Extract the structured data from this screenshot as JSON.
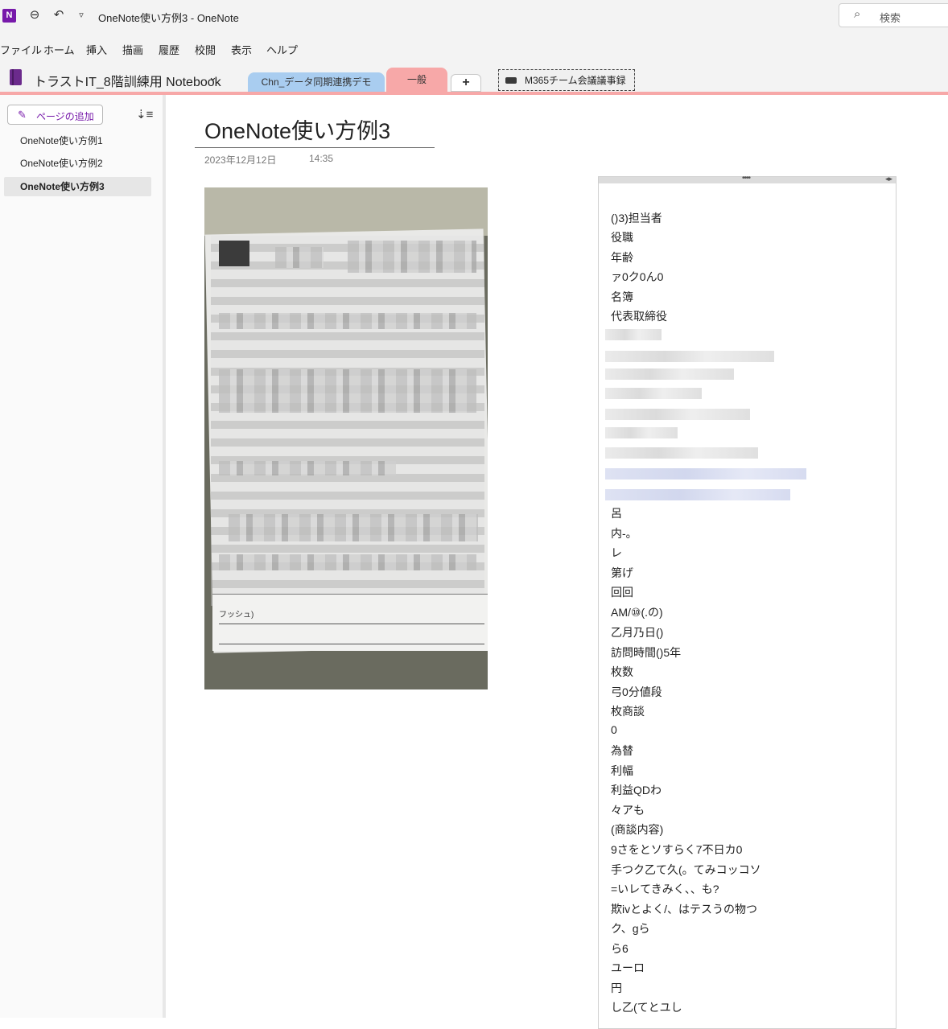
{
  "titlebar": {
    "app_icon": "N",
    "window_title": "OneNote使い方例3  -  OneNote",
    "back_icon": "arrow-left-circle",
    "undo_icon": "undo",
    "customize_icon": "caret-down",
    "search_placeholder": "検索",
    "search_icon": "magnifier"
  },
  "menu": {
    "items": [
      "ファイル",
      "ホーム",
      "挿入",
      "描画",
      "履歴",
      "校閲",
      "表示",
      "ヘルプ"
    ]
  },
  "notebook": {
    "name": "トラストIT_8階訓練用 Notebook",
    "chevron": "⌄"
  },
  "sections": {
    "tab1": "Chn_データ同期連携デモ",
    "tab2": "一般",
    "add": "+",
    "tab3": "M365チーム会議議事録",
    "colors": {
      "tab1": "#a9cdf0",
      "tab2": "#f7a8a8"
    }
  },
  "sidebar": {
    "add_page_label": "ページの追加",
    "pages": [
      "OneNote使い方例1",
      "OneNote使い方例2",
      "OneNote使い方例3"
    ],
    "active_index": 2
  },
  "page": {
    "title": "OneNote使い方例3",
    "date": "2023年12月12日",
    "time": "14:35",
    "photo_caption_fragment": "フッシュ)"
  },
  "ocr": {
    "lines_top": [
      "()3)担当者",
      "役職",
      "年齢",
      "ァ0ク0ん0",
      "名簿",
      "代表取締役"
    ],
    "lines_bottom": [
      "呂",
      "内-。",
      "レ",
      "第げ",
      "回回",
      "AM/⑩(.の)",
      "乙月乃日()",
      "訪問時間()5年",
      "枚数",
      "弓0分値段",
      "枚商談",
      "0",
      "為替",
      "利幅",
      "利益QDわ",
      "々アも",
      "(商談内容)",
      "9さをとソすらく7不日カ0",
      "手つク乙て久(。てみコッコソ",
      "=いレてきみく、、も?",
      "欺ivとよく/、はテスうの物つ",
      "ク、gら",
      "ら6",
      "ユーロ",
      "円",
      "し乙(てとユし"
    ]
  }
}
